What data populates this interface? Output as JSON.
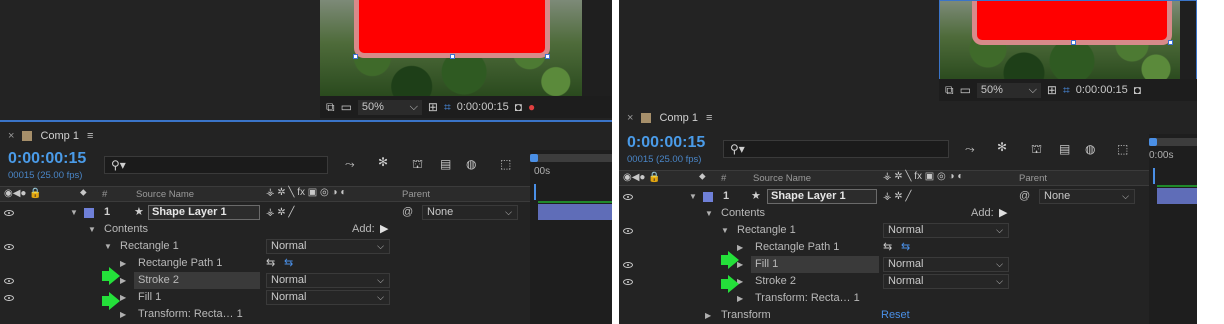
{
  "colors": {
    "accent": "#4a9be8",
    "green_arrow": "#24e03a",
    "shape_red": "#ff0000",
    "layer_label": "#6f80d8"
  },
  "left": {
    "viewer": {
      "zoom": "50%",
      "timecode": "0:00:00:15"
    },
    "comp_tab": "Comp 1",
    "timecode": "0:00:00:15",
    "fps": "00015 (25.00 fps)",
    "search_placeholder": "",
    "time_marker": "00s",
    "columns": {
      "hash": "#",
      "source_name": "Source Name",
      "parent": "Parent"
    },
    "layer": {
      "num": "1",
      "name": "Shape Layer 1",
      "parent": "None"
    },
    "rows": [
      {
        "label": "Contents",
        "extra": "Add:"
      },
      {
        "label": "Rectangle 1",
        "mode": "Normal"
      },
      {
        "label": "Rectangle Path 1"
      },
      {
        "label": "Stroke 2",
        "mode": "Normal"
      },
      {
        "label": "Fill 1",
        "mode": "Normal"
      },
      {
        "label": "Transform: Recta… 1"
      }
    ]
  },
  "right": {
    "viewer": {
      "zoom": "50%",
      "timecode": "0:00:00:15"
    },
    "comp_tab": "Comp 1",
    "timecode": "0:00:00:15",
    "fps": "00015 (25.00 fps)",
    "time_marker": "0:00s",
    "columns": {
      "hash": "#",
      "source_name": "Source Name",
      "parent": "Parent"
    },
    "layer": {
      "num": "1",
      "name": "Shape Layer 1",
      "parent": "None"
    },
    "rows": [
      {
        "label": "Contents",
        "extra": "Add:"
      },
      {
        "label": "Rectangle 1",
        "mode": "Normal"
      },
      {
        "label": "Rectangle Path 1"
      },
      {
        "label": "Fill 1",
        "mode": "Normal"
      },
      {
        "label": "Stroke 2",
        "mode": "Normal"
      },
      {
        "label": "Transform: Recta… 1"
      },
      {
        "label": "Transform",
        "extra": "Reset"
      }
    ]
  }
}
